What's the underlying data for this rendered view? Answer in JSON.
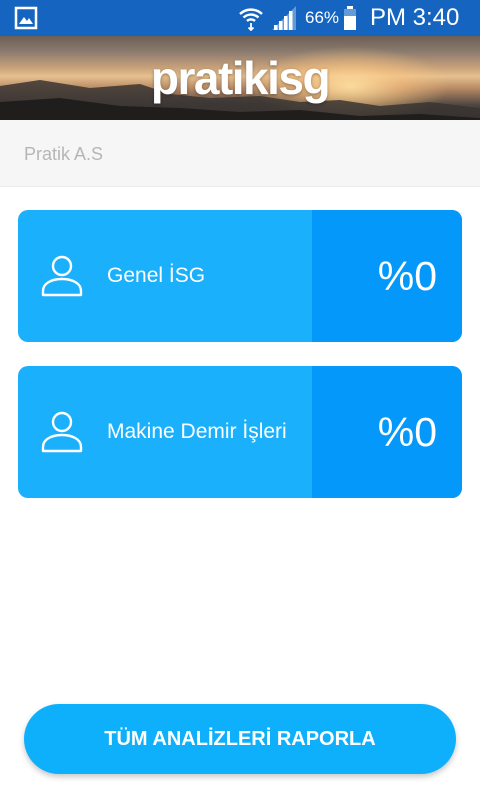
{
  "status_bar": {
    "battery_percent": "66%",
    "time": "PM 3:40",
    "icons": [
      "gallery-icon",
      "wifi-icon",
      "signal-icon",
      "battery-icon"
    ]
  },
  "header": {
    "logo_text": "pratikisg"
  },
  "company": {
    "name": "Pratik A.S"
  },
  "cards": [
    {
      "label": "Genel İSG",
      "percent": "%0",
      "icon": "person-icon"
    },
    {
      "label": "Makine Demir İşleri",
      "percent": "%0",
      "icon": "person-icon"
    }
  ],
  "report_button": {
    "label": "TÜM ANALİZLERİ RAPORLA"
  },
  "colors": {
    "status_bar": "#1565c0",
    "card_left": "#1ab0fb",
    "card_right": "#0598fb",
    "button": "#0fb0fb",
    "company_text": "#b6b6b6"
  }
}
